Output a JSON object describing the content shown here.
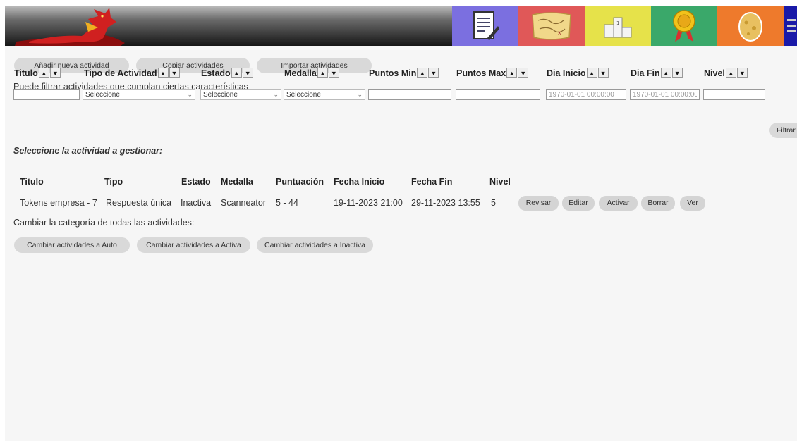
{
  "nav": {
    "tiles": [
      {
        "icon": "clipboard-icon",
        "color": "#7b6fe0"
      },
      {
        "icon": "treasure-map-icon",
        "color": "#e05858"
      },
      {
        "icon": "podium-icon",
        "color": "#e6e24a"
      },
      {
        "icon": "medal-icon",
        "color": "#3aa86a"
      },
      {
        "icon": "dragon-egg-icon",
        "color": "#ee7a2c"
      },
      {
        "icon": "menu-icon",
        "color": "#1a1aa8"
      }
    ]
  },
  "toolbar": {
    "add_label": "Añadir nueva actividad",
    "copy_label": "Copiar actividades",
    "import_label": "Importar actividades"
  },
  "filter": {
    "intro": "Puede filtrar actividades que cumplan ciertas características",
    "labels": {
      "titulo": "Titulo",
      "tipo": "Tipo de Actividad",
      "estado": "Estado",
      "medalla": "Medalla",
      "puntos_min": "Puntos Min",
      "puntos_max": "Puntos Max",
      "dia_inicio": "Dia Inicio",
      "dia_fin": "Dia Fin",
      "nivel": "Nivel"
    },
    "select_placeholder": "Seleccione",
    "dia_inicio_placeholder": "1970-01-01 00:00:00",
    "dia_fin_placeholder": "1970-01-01 00:00:00",
    "filter_button": "Filtrar"
  },
  "table": {
    "heading": "Seleccione la actividad a gestionar:",
    "columns": [
      "Titulo",
      "Tipo",
      "Estado",
      "Medalla",
      "Puntuación",
      "Fecha Inicio",
      "Fecha Fin",
      "Nivel"
    ],
    "rows": [
      {
        "titulo": "Tokens empresa - 7",
        "tipo": "Respuesta única",
        "estado": "Inactiva",
        "medalla": "Scanneator",
        "puntuacion": "5 - 44",
        "fecha_inicio": "19-11-2023 21:00",
        "fecha_fin": "29-11-2023 13:55",
        "nivel": "5",
        "actions": [
          "Revisar",
          "Editar",
          "Activar",
          "Borrar",
          "Ver"
        ]
      }
    ]
  },
  "bulk": {
    "label": "Cambiar la categoría de todas las actividades:",
    "auto_label": "Cambiar actividades a Auto",
    "activa_label": "Cambiar actividades a Activa",
    "inactiva_label": "Cambiar actividades a Inactiva"
  }
}
